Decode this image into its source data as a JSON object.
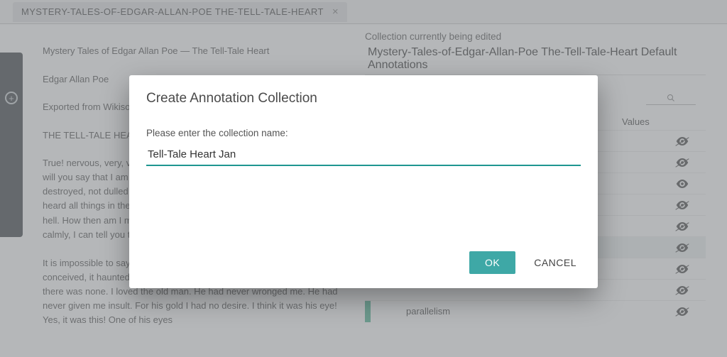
{
  "tab": {
    "label": "MYSTERY-TALES-OF-EDGAR-ALLAN-POE THE-TELL-TALE-HEART"
  },
  "document": {
    "title": "Mystery Tales of Edgar Allan Poe — The Tell-Tale Heart",
    "author": "Edgar Allan Poe",
    "source": "Exported from Wikisource",
    "heading": "THE TELL-TALE HEART.",
    "para1": "True! nervous, very, very dreadfully nervous I had been and am; but why will you say that I am mad? The disease had sharpened my senses, not destroyed, not dulled them. Above all was the sense of hearing acute. I heard all things in the heaven and in the earth. I heard many things in hell. How then am I mad? Hearken! and observe how healthily, how calmly, I can tell you the whole story.",
    "para2": "It is impossible to say how first the idea entered my brain; but, once conceived, it haunted me day and night. Object there was none. Passion there was none. I loved the old man. He had never wronged me. He had never given me insult. For his gold I had no desire. I think it was his eye! Yes, it was this! One of his eyes"
  },
  "rightPanel": {
    "headerLabel": "Collection currently being edited",
    "title": "Mystery-Tales-of-Edgar-Allan-Poe The-Tell-Tale-Heart Default Annotations",
    "valuesHeader": "Values"
  },
  "annotations": [
    {
      "label": "",
      "bar": "",
      "strike": true,
      "hi": false
    },
    {
      "label": "",
      "bar": "",
      "strike": true,
      "hi": false
    },
    {
      "label": "",
      "bar": "",
      "strike": false,
      "hi": false
    },
    {
      "label": "",
      "bar": "",
      "strike": true,
      "hi": false
    },
    {
      "label": "",
      "bar": "",
      "strike": true,
      "hi": false
    },
    {
      "label": "",
      "bar": "",
      "strike": true,
      "hi": true
    },
    {
      "label": "",
      "bar": "",
      "strike": true,
      "hi": false
    },
    {
      "label": "",
      "bar": "",
      "strike": true,
      "hi": false
    },
    {
      "label": "parallelism",
      "bar": "#5cbb9b",
      "strike": true,
      "hi": false
    }
  ],
  "dialog": {
    "title": "Create Annotation Collection",
    "prompt": "Please enter the collection name:",
    "inputValue": "Tell-Tale Heart Jan",
    "ok": "OK",
    "cancel": "CANCEL"
  }
}
